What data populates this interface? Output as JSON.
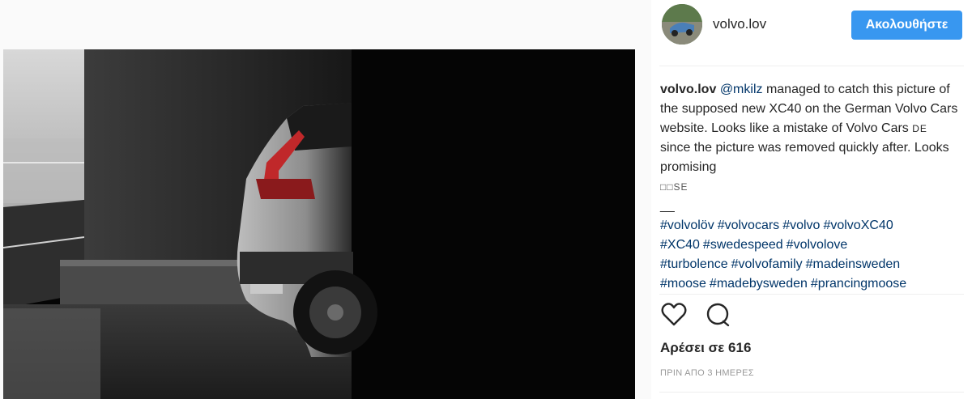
{
  "post": {
    "username": "volvo.lov",
    "follow_label": "Ακολουθήστε",
    "caption": {
      "author": "volvo.lov",
      "mention": "@mkilz",
      "text_1": " managed to catch this picture of the supposed new XC40 on the German Volvo Cars website. Looks like a mistake of Volvo Cars ",
      "smallcaps_1": "DE",
      "text_2": " since the picture was removed quickly after. Looks promising",
      "trailing_symbols": "□□SE",
      "separator": "__"
    },
    "hashtags": [
      "#volvolöv",
      "#volvocars",
      "#volvo",
      "#volvoXC40",
      "#XC40",
      "#swedespeed",
      "#volvolove",
      "#turbolence",
      "#volvofamily",
      "#madeinsweden",
      "#moose",
      "#madebysweden",
      "#prancingmoose"
    ],
    "likes_text": "Αρέσει σε 616",
    "timestamp": "ΠΡΙΝ ΑΠΟ 3 ΗΜΕΡΕΣ",
    "icons": {
      "like": "heart-icon",
      "comment": "comment-icon"
    }
  },
  "colors": {
    "accent": "#3897f0",
    "link": "#003569",
    "text": "#262626",
    "muted": "#999999"
  }
}
